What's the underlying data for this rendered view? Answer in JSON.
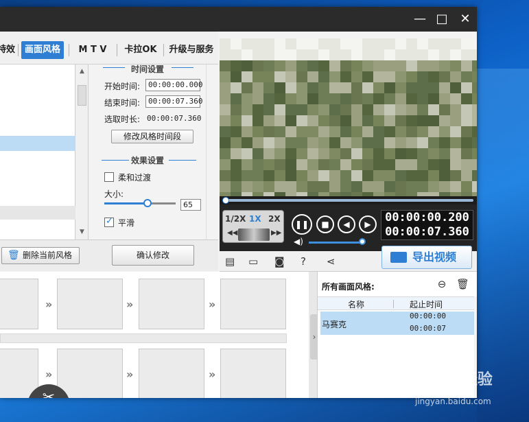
{
  "window": {
    "maximize_icon": "maximize-icon",
    "close_icon": "close-icon"
  },
  "tabs": [
    {
      "label": "特效"
    },
    {
      "label": "画面风格",
      "active": true
    },
    {
      "label": "M T V"
    },
    {
      "label": "卡拉OK"
    },
    {
      "label": "升级与服务"
    }
  ],
  "settings": {
    "time_section": "时间设置",
    "start_label": "开始时间:",
    "start_value": "00:00:00.000",
    "end_label": "结束时间:",
    "end_value": "00:00:07.360",
    "duration_label": "选取时长:",
    "duration_value": "00:00:07.360",
    "modify_time_button": "修改风格时间段",
    "effect_section": "效果设置",
    "soft_transition_label": "柔和过渡",
    "soft_transition_checked": false,
    "size_label": "大小:",
    "size_value": "65",
    "smooth_label": "平滑",
    "smooth_checked": true,
    "confirm_button": "确认修改"
  },
  "left_panel": {
    "delete_button": "删除当前风格"
  },
  "player": {
    "speeds": [
      "1/2X",
      "1X",
      "2X"
    ],
    "active_speed": "1X",
    "current_time": "00:00:00.200",
    "total_time": "00:00:07.360",
    "export_button": "导出视频"
  },
  "style_list": {
    "title": "所有画面风格:",
    "columns": [
      "名称",
      "起止时间"
    ],
    "rows": [
      {
        "name": "马赛克",
        "start": "00:00:00",
        "end": "00:00:07"
      }
    ]
  },
  "colors": {
    "accent": "#2e7fd3",
    "selection": "#bcdcf6",
    "dark": "#2b2b2b"
  }
}
